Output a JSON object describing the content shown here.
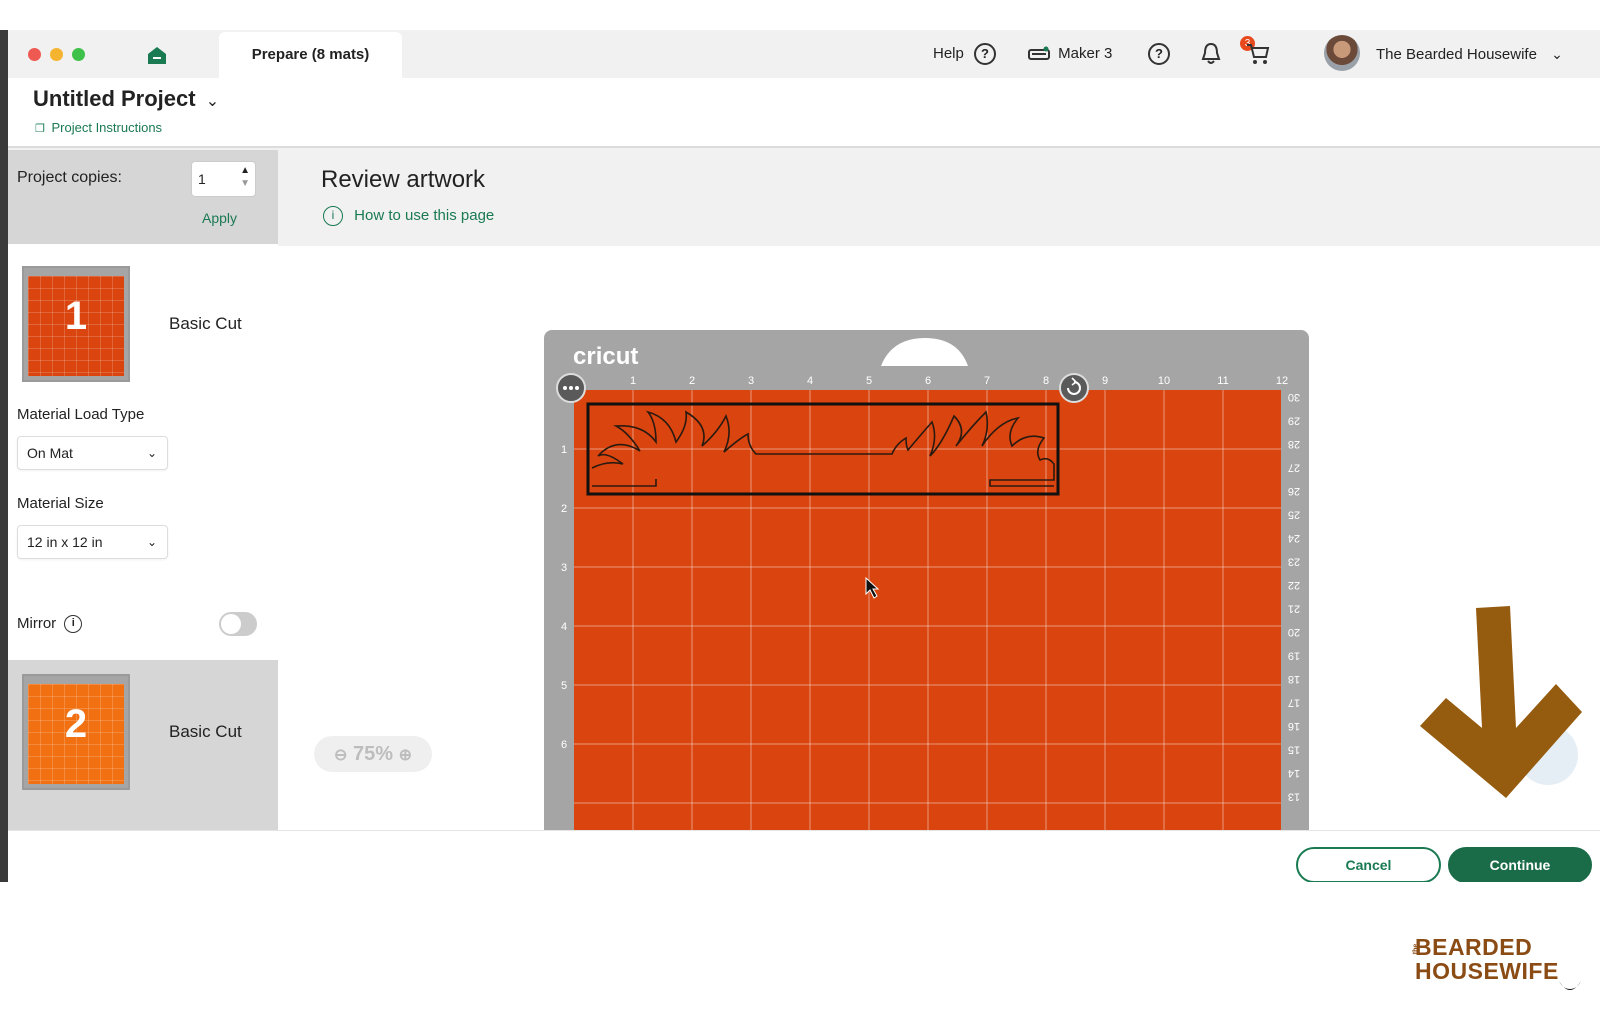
{
  "window": {
    "tab_label": "Prepare (8 mats)"
  },
  "header": {
    "help_label": "Help",
    "machine_label": "Maker 3",
    "notification_count": "3",
    "user_name": "The Bearded Housewife"
  },
  "project": {
    "title": "Untitled Project",
    "instructions_link": "Project Instructions"
  },
  "sidebar": {
    "copies_label": "Project copies:",
    "copies_value": "1",
    "apply_label": "Apply",
    "mats": [
      {
        "number": "1",
        "label": "Basic Cut",
        "color": "#d9440f"
      },
      {
        "number": "2",
        "label": "Basic Cut",
        "color": "#f07012"
      }
    ],
    "load_type_label": "Material Load Type",
    "load_type_value": "On Mat",
    "size_label": "Material Size",
    "size_value": "12 in x 12 in",
    "mirror_label": "Mirror",
    "mirror_on": false
  },
  "main": {
    "title": "Review artwork",
    "howto_link": "How to use this page",
    "zoom_label": "75%",
    "mat_brand": "cricut",
    "ruler_top": [
      "1",
      "2",
      "3",
      "4",
      "5",
      "6",
      "7",
      "8",
      "9",
      "10",
      "11",
      "12"
    ],
    "ruler_left": [
      "1",
      "2",
      "3",
      "4",
      "5",
      "6"
    ],
    "ruler_right": [
      "30",
      "29",
      "28",
      "27",
      "26",
      "25",
      "24",
      "23",
      "22",
      "21",
      "20",
      "19",
      "18",
      "17",
      "16",
      "15",
      "14",
      "13"
    ],
    "mat_color": "#d9440f"
  },
  "footer": {
    "cancel_label": "Cancel",
    "continue_label": "Continue"
  },
  "watermark": {
    "line1": "BEARDED",
    "line2": "HOUSEWIFE",
    "prefix": "the"
  },
  "colors": {
    "accent_green": "#1a7a52",
    "arrow_brown": "#955b0e"
  }
}
